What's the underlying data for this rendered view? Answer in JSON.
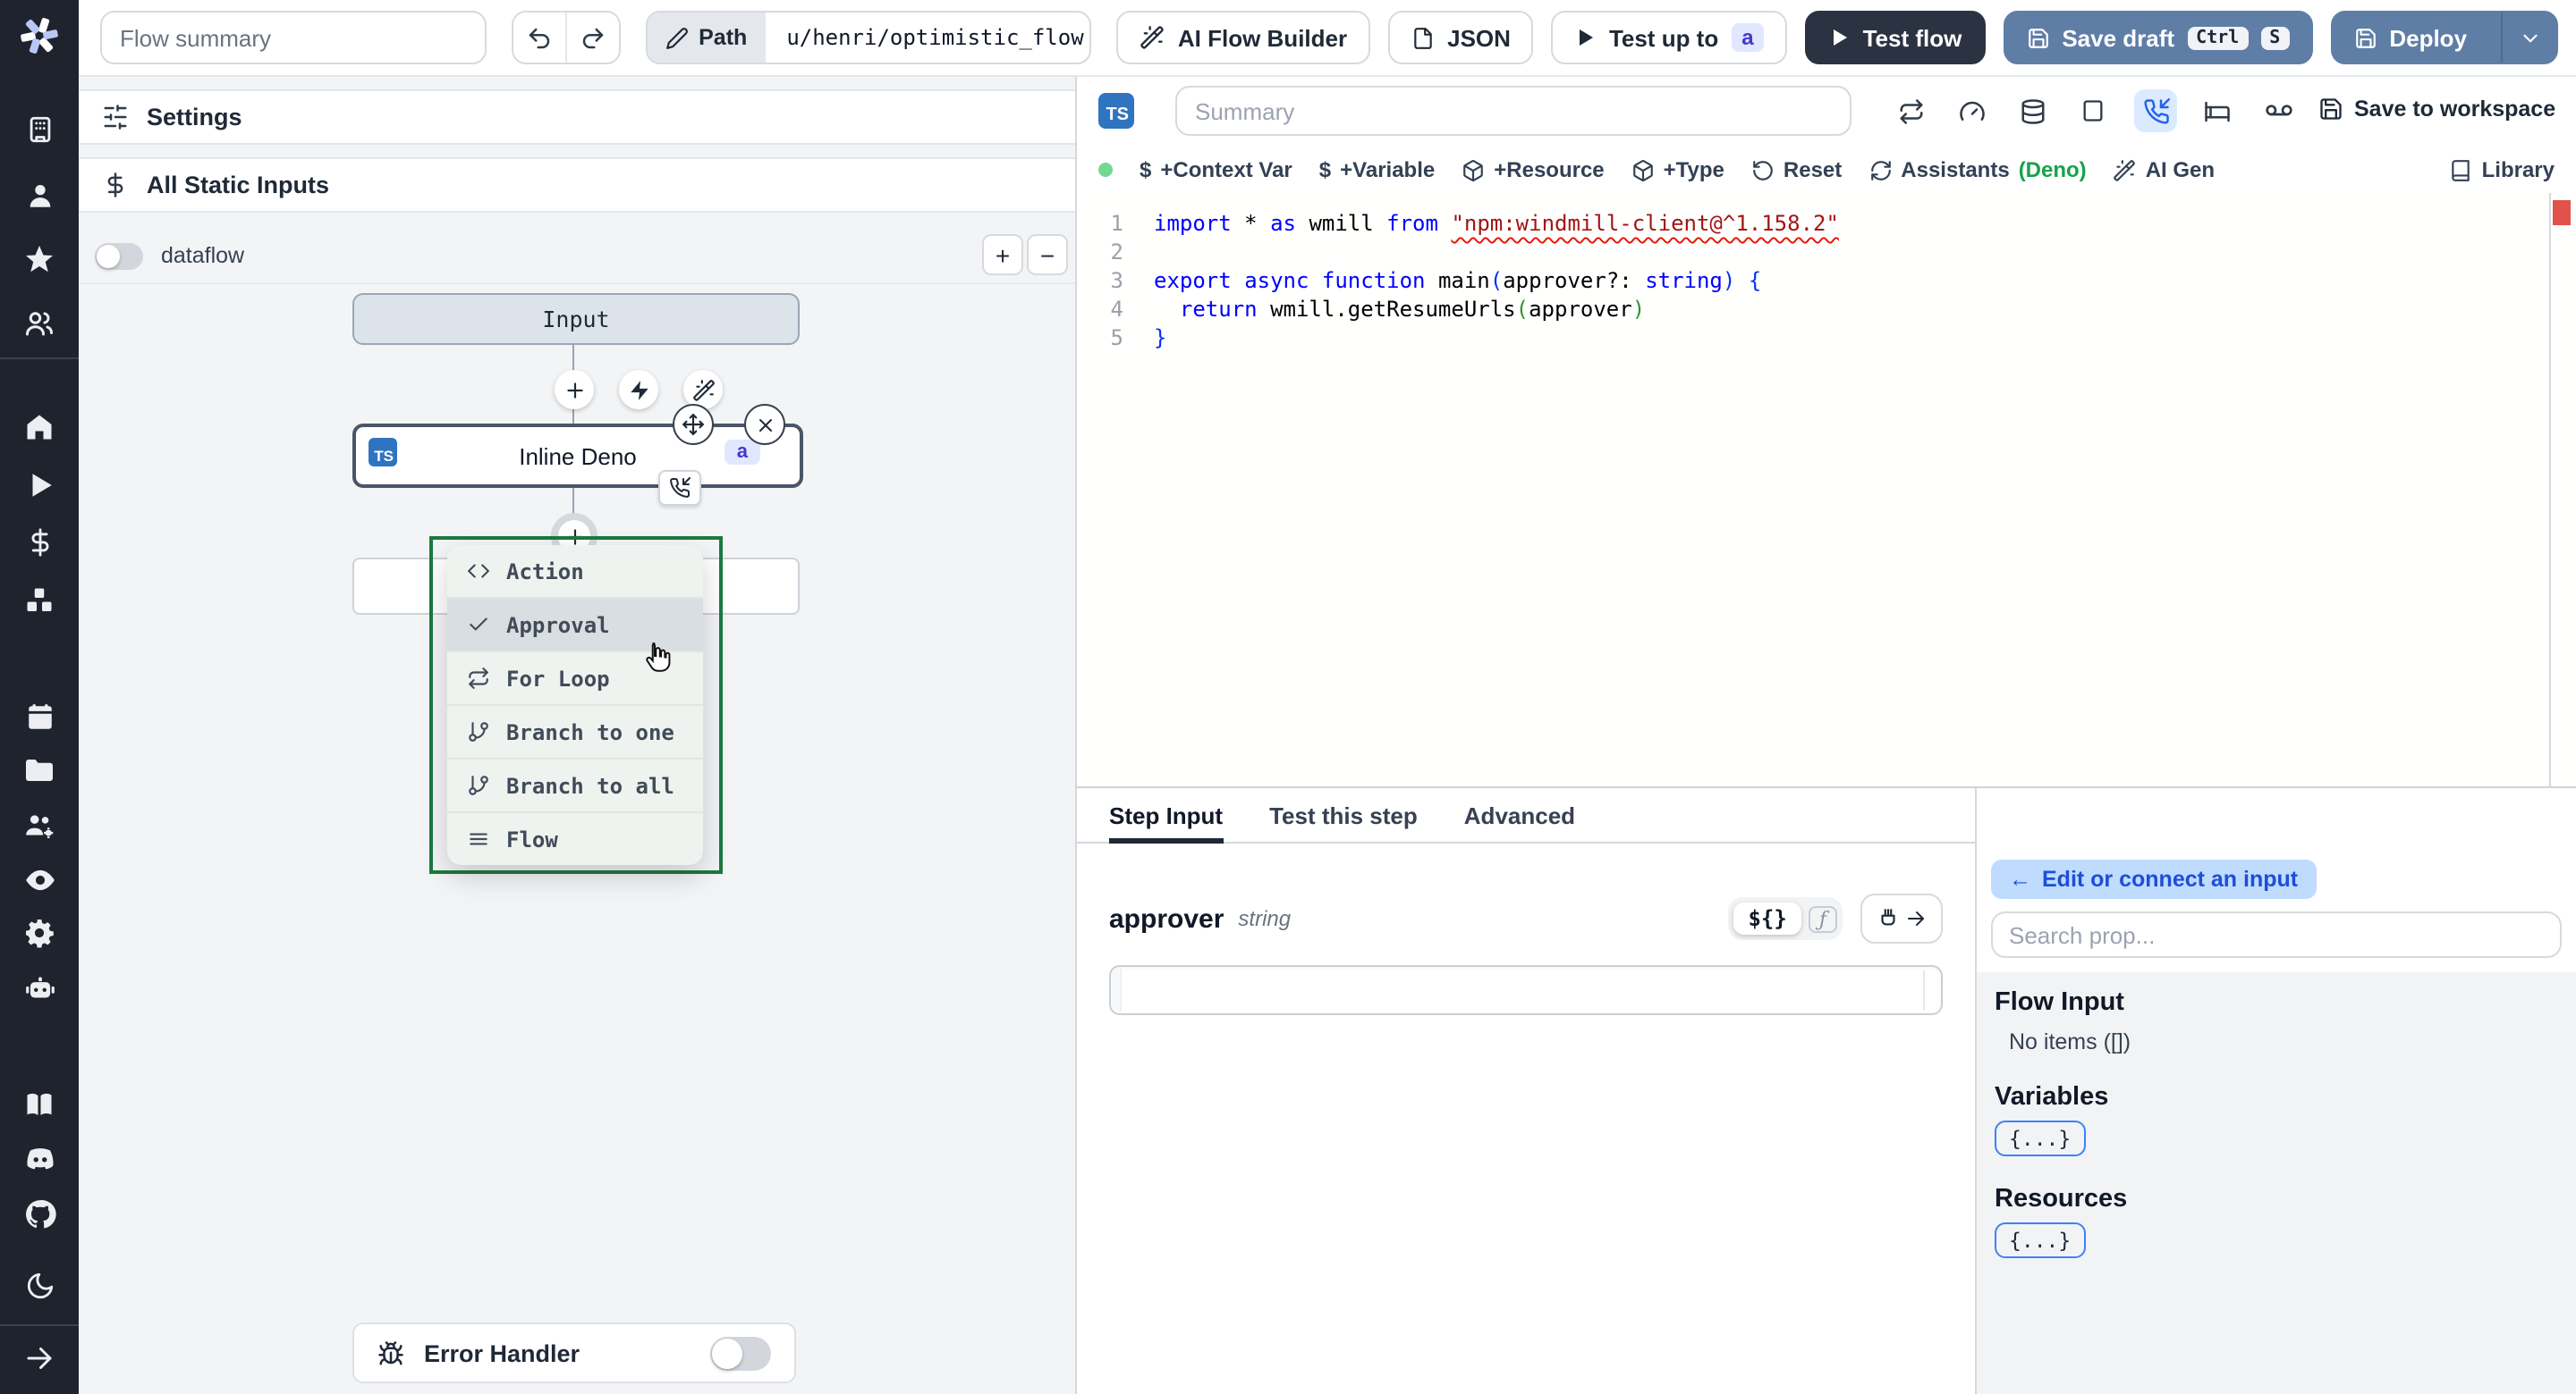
{
  "topbar": {
    "flow_summary_placeholder": "Flow summary",
    "path_label": "Path",
    "path_value": "u/henri/optimistic_flow",
    "ai_flow_builder": "AI Flow Builder",
    "json_label": "JSON",
    "test_up_to": "Test up to",
    "test_up_to_badge": "a",
    "test_flow": "Test flow",
    "save_draft": "Save draft",
    "save_draft_kbd": [
      "Ctrl",
      "S"
    ],
    "deploy": "Deploy"
  },
  "sidebar": {
    "icons": [
      "windmill-logo",
      "building",
      "user",
      "star",
      "users",
      "home",
      "play",
      "dollar",
      "boxes",
      "calendar",
      "folder",
      "users-gear",
      "eye",
      "gear",
      "robot",
      "book",
      "discord",
      "github",
      "moon",
      "arrow-right"
    ]
  },
  "left_panel": {
    "settings_label": "Settings",
    "static_inputs_label": "All Static Inputs",
    "dataflow_label": "dataflow",
    "zoom_in": "+",
    "zoom_out": "−",
    "graph": {
      "input_label": "Input",
      "step_label": "Inline Deno",
      "step_lang_badge": "TS",
      "step_id_badge": "a",
      "menu": {
        "items": [
          {
            "label": "Action",
            "icon": "code-icon"
          },
          {
            "label": "Approval",
            "icon": "check-icon"
          },
          {
            "label": "For Loop",
            "icon": "repeat-icon"
          },
          {
            "label": "Branch to one",
            "icon": "git-branch-icon"
          },
          {
            "label": "Branch to all",
            "icon": "git-branch-icon"
          },
          {
            "label": "Flow",
            "icon": "menu-icon"
          }
        ]
      },
      "error_handler_label": "Error Handler"
    }
  },
  "editor": {
    "lang_badge": "TS",
    "summary_placeholder": "Summary",
    "save_to_workspace": "Save to workspace",
    "header_icons": [
      "repeat",
      "gauge",
      "database",
      "square",
      "phone-incoming",
      "bed",
      "voicemail"
    ],
    "toolbar": {
      "dollar": "$",
      "context_var": "+Context Var",
      "variable": "+Variable",
      "resource": "+Resource",
      "type": "+Type",
      "reset": "Reset",
      "assistants": "Assistants",
      "assistants_lang": "(Deno)",
      "ai_gen": "AI Gen",
      "library": "Library"
    },
    "code": {
      "line_numbers": [
        "1",
        "2",
        "3",
        "4",
        "5"
      ],
      "lines": [
        {
          "tokens": [
            {
              "t": "import"
            },
            {
              "t": " * "
            },
            {
              "t": "as"
            },
            {
              "t": " wmill "
            },
            {
              "t": "from"
            },
            {
              "t": " "
            },
            {
              "t": "\"npm:windmill-client@^1.158.2\""
            }
          ]
        },
        {
          "tokens": []
        },
        {
          "tokens": [
            {
              "t": "export"
            },
            {
              "t": " "
            },
            {
              "t": "async"
            },
            {
              "t": " "
            },
            {
              "t": "function"
            },
            {
              "t": " main"
            },
            {
              "t": "("
            },
            {
              "t": "approver?: "
            },
            {
              "t": "string"
            },
            {
              "t": ")"
            },
            {
              "t": " "
            },
            {
              "t": "{"
            }
          ]
        },
        {
          "tokens": [
            {
              "t": "  "
            },
            {
              "t": "return"
            },
            {
              "t": " wmill.getResumeUrls"
            },
            {
              "t": "("
            },
            {
              "t": "approver"
            },
            {
              "t": ")"
            }
          ]
        },
        {
          "tokens": [
            {
              "t": "}"
            }
          ]
        }
      ]
    }
  },
  "step_panel": {
    "tabs": [
      "Step Input",
      "Test this step",
      "Advanced"
    ],
    "field_name": "approver",
    "field_type": "string",
    "templatable_toggle": "${}",
    "fn_toggle": "ƒ"
  },
  "connect_panel": {
    "back_arrow": "←",
    "edit_or_connect": "Edit or connect an input",
    "search_placeholder": "Search prop...",
    "flow_input_title": "Flow Input",
    "flow_input_empty": "No items ([])",
    "variables_title": "Variables",
    "variables_chip": "{...}",
    "resources_title": "Resources",
    "resources_chip": "{...}"
  },
  "colors": {
    "accent_blue": "#2f74c0",
    "slate_button": "#5f7ea6",
    "dark_button": "#2b3342",
    "menu_border_green": "#1c7a3e",
    "deno_green": "#16a34a",
    "error_red": "#e0524a"
  }
}
